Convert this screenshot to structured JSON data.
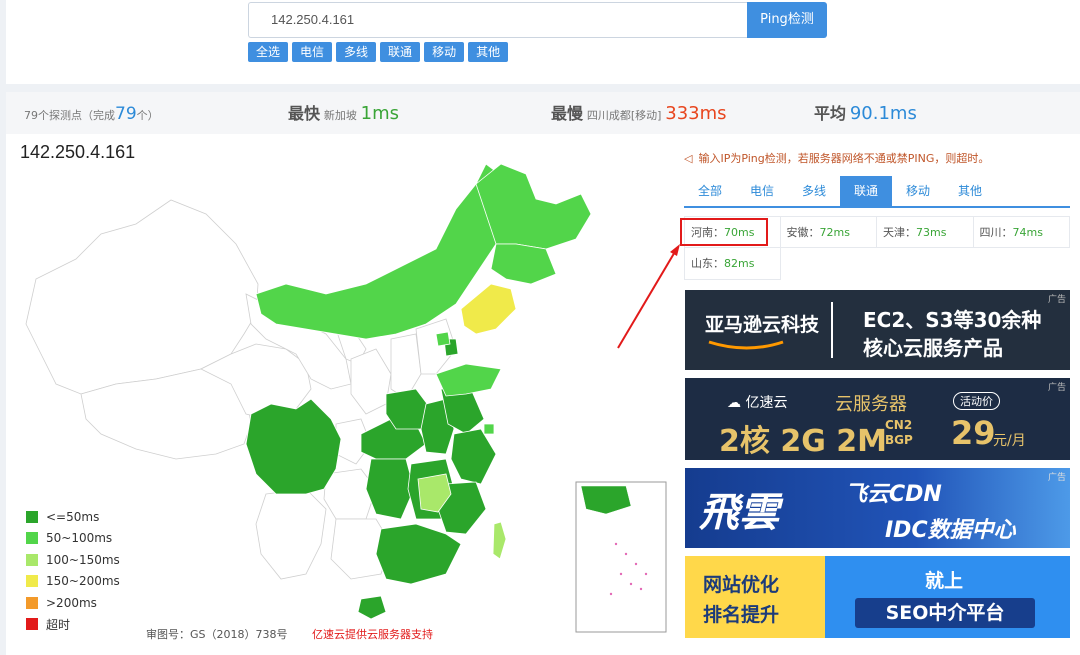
{
  "search": {
    "ip": "142.250.4.161",
    "button": "Ping检测"
  },
  "filters": [
    "全选",
    "电信",
    "多线",
    "联通",
    "移动",
    "其他"
  ],
  "stats": {
    "points_prefix": "79个探测点（完成",
    "points_count": "79",
    "points_suffix": "个）",
    "fastest_label": "最快",
    "fastest_loc": "新加坡",
    "fastest_val": "1ms",
    "slowest_label": "最慢",
    "slowest_loc": "四川成都[移动]",
    "slowest_val": "333ms",
    "avg_label": "平均",
    "avg_val": "90.1ms"
  },
  "map": {
    "ip": "142.250.4.161",
    "legend": [
      {
        "label": "<=50ms",
        "color": "#2ba52b"
      },
      {
        "label": "50~100ms",
        "color": "#52d54a"
      },
      {
        "label": "100~150ms",
        "color": "#a9e86a"
      },
      {
        "label": "150~200ms",
        "color": "#f0ea4a"
      },
      {
        "label": ">200ms",
        "color": "#f39a2a"
      },
      {
        "label": "超时",
        "color": "#e21a1a"
      }
    ],
    "footer_review": "审图号：GS（2018）738号",
    "footer_sponsor": "亿速云提供云服务器支持"
  },
  "panel": {
    "notice": "输入IP为Ping检测，若服务器网络不通或禁PING，则超时。",
    "tabs": [
      "全部",
      "电信",
      "多线",
      "联通",
      "移动",
      "其他"
    ],
    "active_tab": "联通",
    "results": [
      [
        {
          "label": "河南：",
          "value": "70ms"
        },
        {
          "label": "安徽：",
          "value": "72ms"
        },
        {
          "label": "天津：",
          "value": "73ms"
        },
        {
          "label": "四川：",
          "value": "74ms"
        }
      ],
      [
        {
          "label": "山东：",
          "value": "82ms"
        }
      ]
    ]
  },
  "ads": {
    "tag": "广告",
    "ad1": {
      "brand": "亚马逊云科技",
      "line1": "EC2、S3等30余种",
      "line2": "核心云服务产品"
    },
    "ad2": {
      "brand": "亿速云",
      "title": "云服务器",
      "badge": "活动价",
      "spec": "2核 2G 2M",
      "net1": "CN2",
      "net2": "BGP",
      "price": "29",
      "unit": "元/月"
    },
    "ad3": {
      "logo": "飛雲",
      "line1": "飞云CDN",
      "line2": "IDC数据中心"
    },
    "ad4": {
      "left1": "网站优化",
      "left2": "排名提升",
      "right1": "就上",
      "right2": "SEO中介平台"
    }
  }
}
